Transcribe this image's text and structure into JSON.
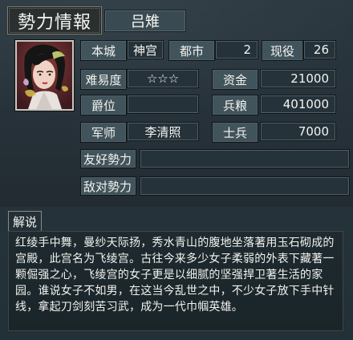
{
  "header": {
    "section_title": "勢力情報",
    "force_name": "吕雉"
  },
  "info": {
    "capital_label": "本城",
    "capital_value": "神宫",
    "cities_label": "都市",
    "cities_value": "2",
    "officers_label": "现役",
    "officers_value": "26",
    "difficulty_label": "难易度",
    "difficulty_value": "☆☆☆",
    "funds_label": "资金",
    "funds_value": "21000",
    "rank_label": "爵位",
    "rank_value": "",
    "food_label": "兵粮",
    "food_value": "401000",
    "strategist_label": "军师",
    "strategist_value": "李清照",
    "soldiers_label": "士兵",
    "soldiers_value": "7000",
    "allies_label": "友好勢力",
    "allies_value": "",
    "enemies_label": "敌对勢力",
    "enemies_value": ""
  },
  "explain": {
    "tab_label": "解说",
    "text": "红绫手中舞，曼纱天际扬，秀水青山的腹地坐落著用玉石砌成的宫殿，此宫名为飞绫宫。古往今来多少女子柔弱的外表下藏著一颗倔强之心，飞绫宫的女子更是以细腻的坚强捍卫著生活的家园。谁说女子不如男，在这当今乱世之中，不少女子放下手中针线，拿起刀剑刻苦习武，成为一代巾帼英雄。"
  }
}
